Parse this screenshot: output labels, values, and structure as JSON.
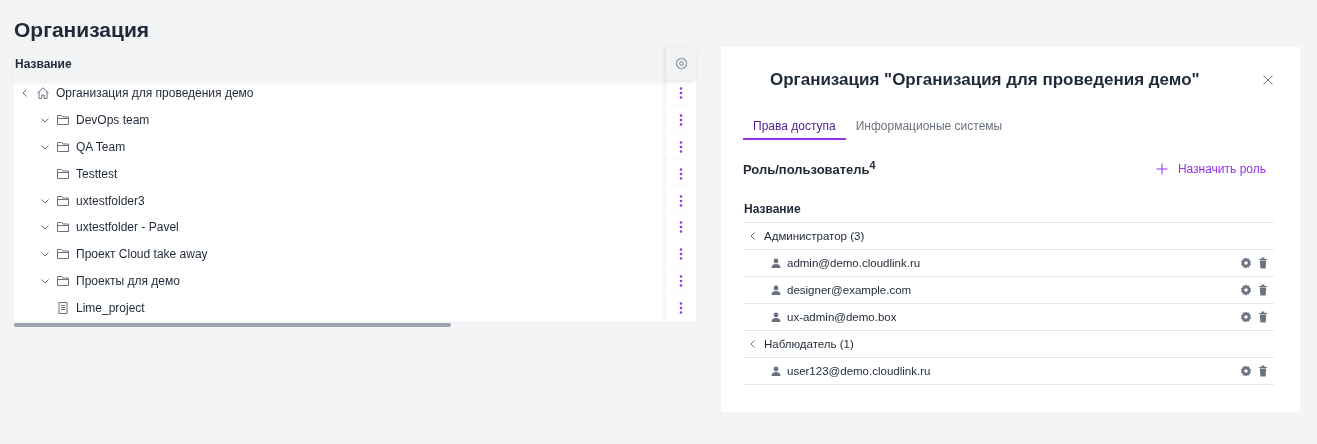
{
  "page": {
    "title": "Организация"
  },
  "tree": {
    "column": "Название",
    "root": {
      "label": "Организация для проведения демо",
      "kind": "home",
      "expanded": true,
      "children": [
        {
          "label": "DevOps team",
          "kind": "folder",
          "expanded": false
        },
        {
          "label": "QA Team",
          "kind": "folder",
          "expanded": false
        },
        {
          "label": "Testtest",
          "kind": "folder"
        },
        {
          "label": "uxtestfolder3",
          "kind": "folder",
          "expanded": false
        },
        {
          "label": "uxtestfolder - Pavel",
          "kind": "folder",
          "expanded": false
        },
        {
          "label": "Проект Cloud take away",
          "kind": "folder",
          "expanded": false
        },
        {
          "label": "Проекты для демо",
          "kind": "folder",
          "expanded": false
        },
        {
          "label": "Lime_project",
          "kind": "document"
        }
      ]
    }
  },
  "panel": {
    "title": "Организация \"Организация для проведения демо\"",
    "tabs": [
      {
        "label": "Права доступа",
        "selected": true
      },
      {
        "label": "Информационые системы",
        "selected": false
      }
    ],
    "section_title": "Роль/пользователь$^{4}$",
    "assign_button": "Назначить роль",
    "table_column": "Название",
    "groups": [
      {
        "label": "Администратор (3)",
        "expanded": true,
        "users": [
          "admin@demo.cloudlink.ru",
          "designer@example.com",
          "ux-admin@demo.box"
        ]
      },
      {
        "label": "Наблюдатель (1)",
        "expanded": true,
        "users": [
          "user123@demo.cloudlink.ru"
        ]
      }
    ]
  }
}
